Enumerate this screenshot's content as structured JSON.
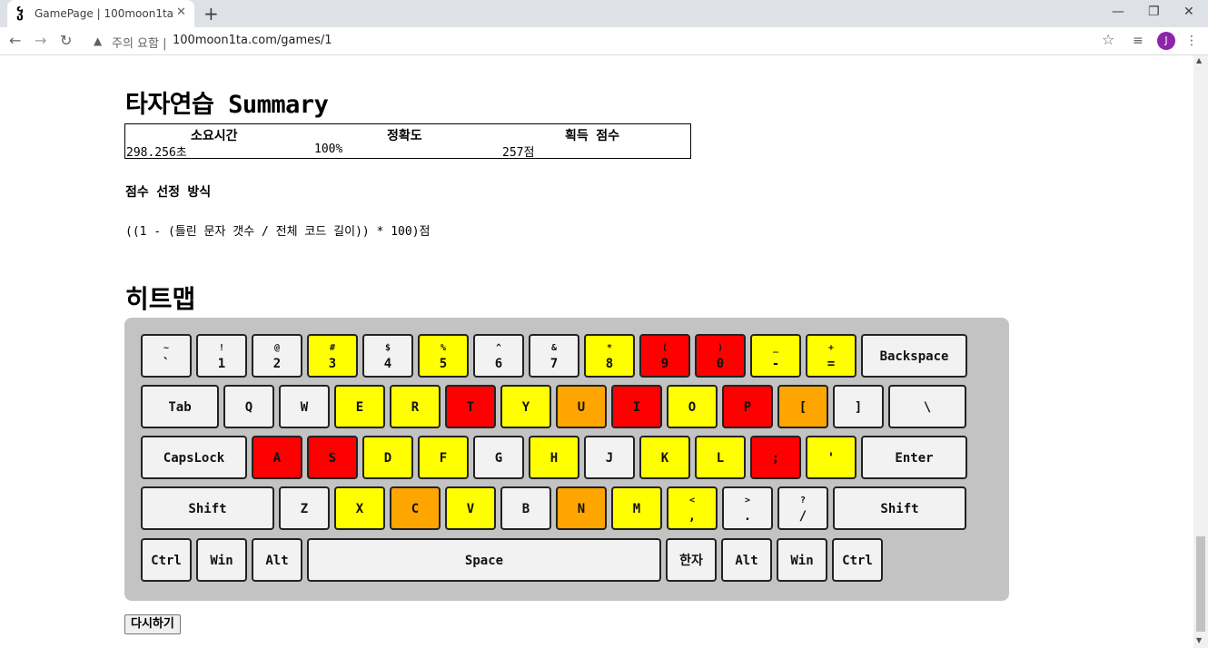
{
  "browser": {
    "tab_title": "GamePage | 100moon1ta",
    "new_tab": "+",
    "security_warning": "주의 요함 |",
    "url": "100moon1ta.com/games/1",
    "avatar_letter": "J"
  },
  "page": {
    "title": "타자연습 Summary",
    "summary": {
      "headers": [
        "소요시간",
        "정확도",
        "획득 점수"
      ],
      "values": [
        "298.256초",
        "100%",
        "257점"
      ]
    },
    "method_title": "점수 선정 방식",
    "formula": "((1 - (틀린 문자 갯수 / 전체 코드 길이)) * 100)점",
    "heatmap_title": "히트맵",
    "retry_label": "다시하기"
  },
  "heat_colors": {
    "none": "#f2f2f2",
    "low": "#ffff00",
    "mid": "#ffa500",
    "high": "#ff0000"
  },
  "keyboard": {
    "rows": [
      [
        {
          "shift": "~",
          "main": "`",
          "heat": "none"
        },
        {
          "shift": "!",
          "main": "1",
          "heat": "none"
        },
        {
          "shift": "@",
          "main": "2",
          "heat": "none"
        },
        {
          "shift": "#",
          "main": "3",
          "heat": "low"
        },
        {
          "shift": "$",
          "main": "4",
          "heat": "none"
        },
        {
          "shift": "%",
          "main": "5",
          "heat": "low"
        },
        {
          "shift": "^",
          "main": "6",
          "heat": "none"
        },
        {
          "shift": "&",
          "main": "7",
          "heat": "none"
        },
        {
          "shift": "*",
          "main": "8",
          "heat": "low"
        },
        {
          "shift": "(",
          "main": "9",
          "heat": "high"
        },
        {
          "shift": ")",
          "main": "0",
          "heat": "high"
        },
        {
          "shift": "_",
          "main": "-",
          "heat": "low"
        },
        {
          "shift": "+",
          "main": "=",
          "heat": "low"
        },
        {
          "main": "Backspace",
          "heat": "none"
        }
      ],
      [
        {
          "main": "Tab",
          "heat": "none"
        },
        {
          "main": "Q",
          "heat": "none"
        },
        {
          "main": "W",
          "heat": "none"
        },
        {
          "main": "E",
          "heat": "low"
        },
        {
          "main": "R",
          "heat": "low"
        },
        {
          "main": "T",
          "heat": "high"
        },
        {
          "main": "Y",
          "heat": "low"
        },
        {
          "main": "U",
          "heat": "mid"
        },
        {
          "main": "I",
          "heat": "high"
        },
        {
          "main": "O",
          "heat": "low"
        },
        {
          "main": "P",
          "heat": "high"
        },
        {
          "main": "[",
          "heat": "mid"
        },
        {
          "main": "]",
          "heat": "none"
        },
        {
          "main": "\\",
          "heat": "none"
        }
      ],
      [
        {
          "main": "CapsLock",
          "heat": "none"
        },
        {
          "main": "A",
          "heat": "high"
        },
        {
          "main": "S",
          "heat": "high"
        },
        {
          "main": "D",
          "heat": "low"
        },
        {
          "main": "F",
          "heat": "low"
        },
        {
          "main": "G",
          "heat": "none"
        },
        {
          "main": "H",
          "heat": "low"
        },
        {
          "main": "J",
          "heat": "none"
        },
        {
          "main": "K",
          "heat": "low"
        },
        {
          "main": "L",
          "heat": "low"
        },
        {
          "main": ";",
          "heat": "high"
        },
        {
          "main": "'",
          "heat": "low"
        },
        {
          "main": "Enter",
          "heat": "none"
        }
      ],
      [
        {
          "main": "Shift",
          "heat": "none"
        },
        {
          "main": "Z",
          "heat": "none"
        },
        {
          "main": "X",
          "heat": "low"
        },
        {
          "main": "C",
          "heat": "mid"
        },
        {
          "main": "V",
          "heat": "low"
        },
        {
          "main": "B",
          "heat": "none"
        },
        {
          "main": "N",
          "heat": "mid"
        },
        {
          "main": "M",
          "heat": "low"
        },
        {
          "shift": "<",
          "main": ",",
          "heat": "low"
        },
        {
          "shift": ">",
          "main": ".",
          "heat": "none"
        },
        {
          "shift": "?",
          "main": "/",
          "heat": "none"
        },
        {
          "main": "Shift",
          "heat": "none"
        }
      ],
      [
        {
          "main": "Ctrl",
          "heat": "none"
        },
        {
          "main": "Win",
          "heat": "none"
        },
        {
          "main": "Alt",
          "heat": "none"
        },
        {
          "main": "Space",
          "heat": "none"
        },
        {
          "main": "한자",
          "heat": "none"
        },
        {
          "main": "Alt",
          "heat": "none"
        },
        {
          "main": "Win",
          "heat": "none"
        },
        {
          "main": "Ctrl",
          "heat": "none"
        }
      ]
    ]
  }
}
